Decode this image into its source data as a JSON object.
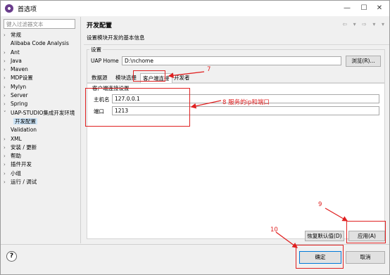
{
  "window": {
    "title": "首选项",
    "minimize": "—",
    "maximize": "☐",
    "close": "✕"
  },
  "sidebar": {
    "filter_placeholder": "键入过滤器文本",
    "items": [
      {
        "label": "常规",
        "arrow": "›"
      },
      {
        "label": "Alibaba Code Analysis",
        "arrow": ""
      },
      {
        "label": "Ant",
        "arrow": "›"
      },
      {
        "label": "Java",
        "arrow": "›"
      },
      {
        "label": "Maven",
        "arrow": "›"
      },
      {
        "label": "MDP设置",
        "arrow": "›"
      },
      {
        "label": "Mylyn",
        "arrow": "›"
      },
      {
        "label": "Server",
        "arrow": "›"
      },
      {
        "label": "Spring",
        "arrow": "›"
      },
      {
        "label": "UAP-STUDIO集成开发环境",
        "arrow": "˅"
      },
      {
        "label": "开发配置",
        "arrow": ""
      },
      {
        "label": "Validation",
        "arrow": ""
      },
      {
        "label": "XML",
        "arrow": "›"
      },
      {
        "label": "安装 / 更新",
        "arrow": "›"
      },
      {
        "label": "帮助",
        "arrow": "›"
      },
      {
        "label": "插件开发",
        "arrow": "›"
      },
      {
        "label": "小组",
        "arrow": "›"
      },
      {
        "label": "运行 / 调试",
        "arrow": "›"
      }
    ]
  },
  "panel": {
    "title": "开发配置",
    "nav_icons": "⇦ ▾ ⇨ ▾ ▾",
    "description": "设置模块开发的基本信息",
    "group_label": "设置",
    "uap_home_label": "UAP Home",
    "uap_home_value": "D:\\nchome",
    "browse_button": "浏览(R)...",
    "tabs": [
      "数据源",
      "模块选择",
      "客户端连接",
      "开发者"
    ],
    "content_title": "客户端连接设置",
    "host_label": "主机名",
    "host_value": "127.0.0.1",
    "port_label": "端口",
    "port_value": "1213",
    "restore_button": "恢复默认值(D)",
    "apply_button": "应用(A)"
  },
  "footer": {
    "help": "?",
    "ok_button": "确定",
    "cancel_button": "取消"
  },
  "annotations": {
    "color": "#e02020",
    "label_7": "7",
    "label_8": "8 服务的ip和端口",
    "label_9": "9",
    "label_10": "10"
  }
}
